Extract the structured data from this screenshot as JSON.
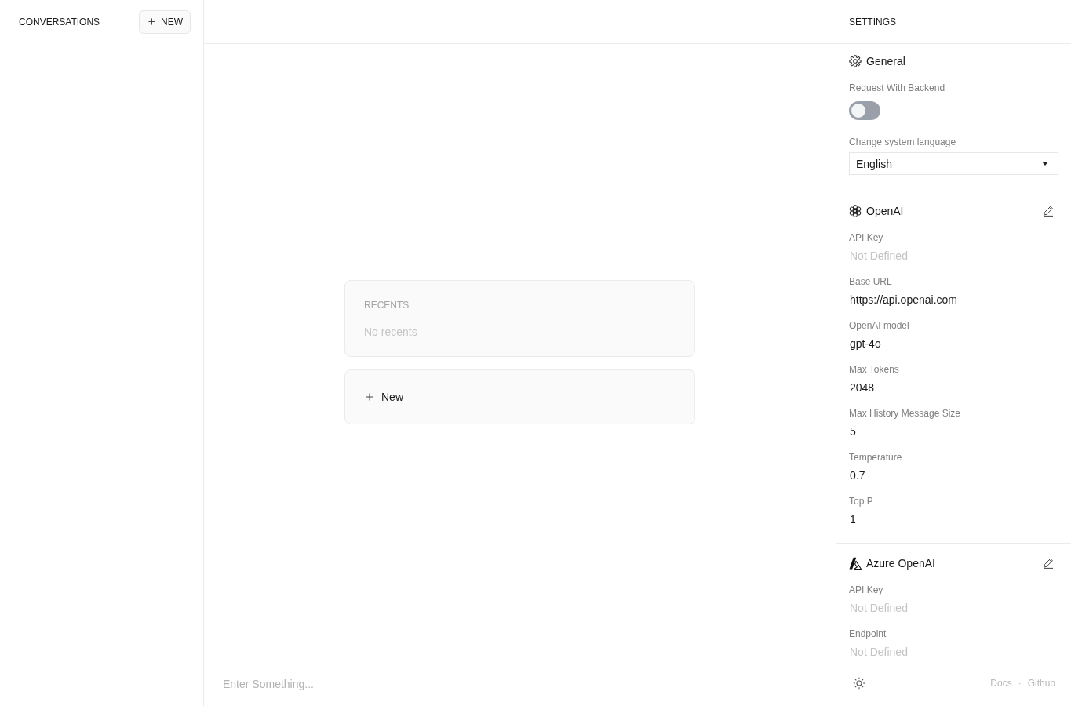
{
  "sidebar": {
    "title": "CONVERSATIONS",
    "new_button": {
      "label": "NEW"
    }
  },
  "main": {
    "recents": {
      "title": "RECENTS",
      "empty_text": "No recents"
    },
    "new_card": {
      "label": "New"
    },
    "composer": {
      "placeholder": "Enter Something..."
    }
  },
  "settings": {
    "title": "SETTINGS",
    "sections": [
      {
        "kind": "general",
        "title": "General",
        "editable": false,
        "items": [
          {
            "kind": "toggle",
            "label": "Request With Backend",
            "on": false
          },
          {
            "kind": "select",
            "label": "Change system language",
            "value": "English"
          }
        ]
      },
      {
        "kind": "openai",
        "title": "OpenAI",
        "editable": true,
        "items": [
          {
            "kind": "field",
            "label": "API Key",
            "placeholder": "Not Defined"
          },
          {
            "kind": "field",
            "label": "Base URL",
            "value": "https://api.openai.com"
          },
          {
            "kind": "field",
            "label": "OpenAI model",
            "value": "gpt-4o"
          },
          {
            "kind": "field",
            "label": "Max Tokens",
            "value": "2048"
          },
          {
            "kind": "field",
            "label": "Max History Message Size",
            "value": "5"
          },
          {
            "kind": "field",
            "label": "Temperature",
            "value": "0.7"
          },
          {
            "kind": "field",
            "label": "Top P",
            "value": "1"
          }
        ]
      },
      {
        "kind": "azure",
        "title": "Azure OpenAI",
        "editable": true,
        "items": [
          {
            "kind": "field",
            "label": "API Key",
            "placeholder": "Not Defined"
          },
          {
            "kind": "field",
            "label": "Endpoint",
            "placeholder": "Not Defined"
          }
        ]
      }
    ],
    "footer": {
      "links": [
        "Docs",
        "Github"
      ],
      "separator": "·"
    }
  }
}
